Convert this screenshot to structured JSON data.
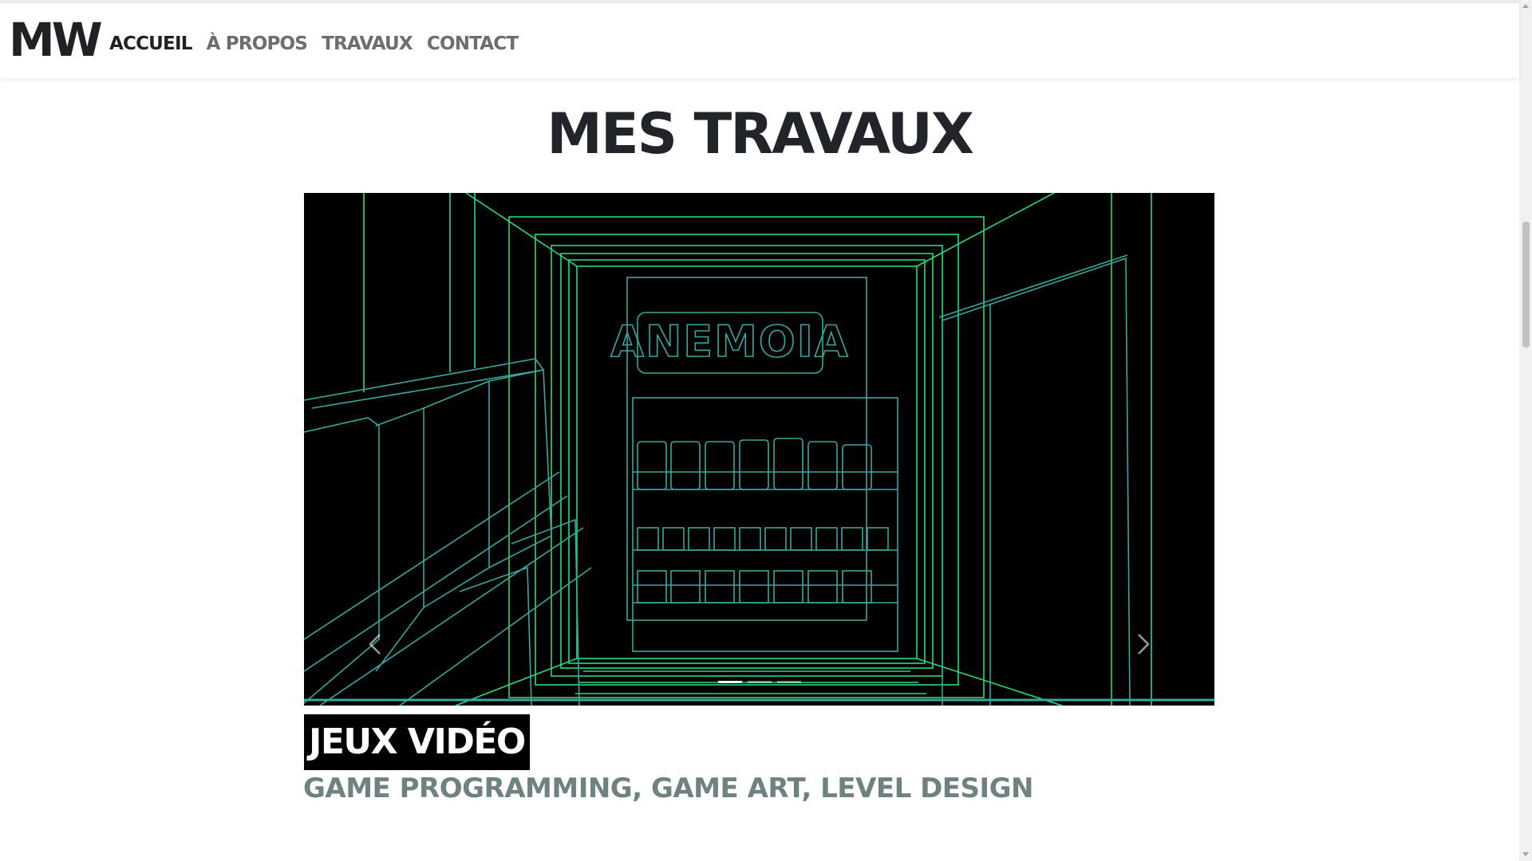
{
  "brand": {
    "logo_text": "MW"
  },
  "nav": {
    "items": [
      {
        "label": "ACCUEIL",
        "active": true
      },
      {
        "label": "À PROPOS",
        "active": false
      },
      {
        "label": "TRAVAUX",
        "active": false
      },
      {
        "label": "CONTACT",
        "active": false
      }
    ]
  },
  "page": {
    "title": "MES TRAVAUX"
  },
  "carousel": {
    "slide_image_text": "ANEMOIA",
    "slide_count": 3,
    "active_slide": 1,
    "prev_icon": "chevron-left-icon",
    "next_icon": "chevron-right-icon"
  },
  "caption": {
    "title": "JEUX VIDÉO",
    "subtitle": "GAME PROGRAMMING, GAME ART, LEVEL DESIGN"
  },
  "colors": {
    "text_dark": "#212529",
    "nav_inactive": "#6b6d70",
    "subtitle": "#6f8181",
    "wire_green": "#2bd977",
    "wire_teal": "#3aa6a0"
  }
}
